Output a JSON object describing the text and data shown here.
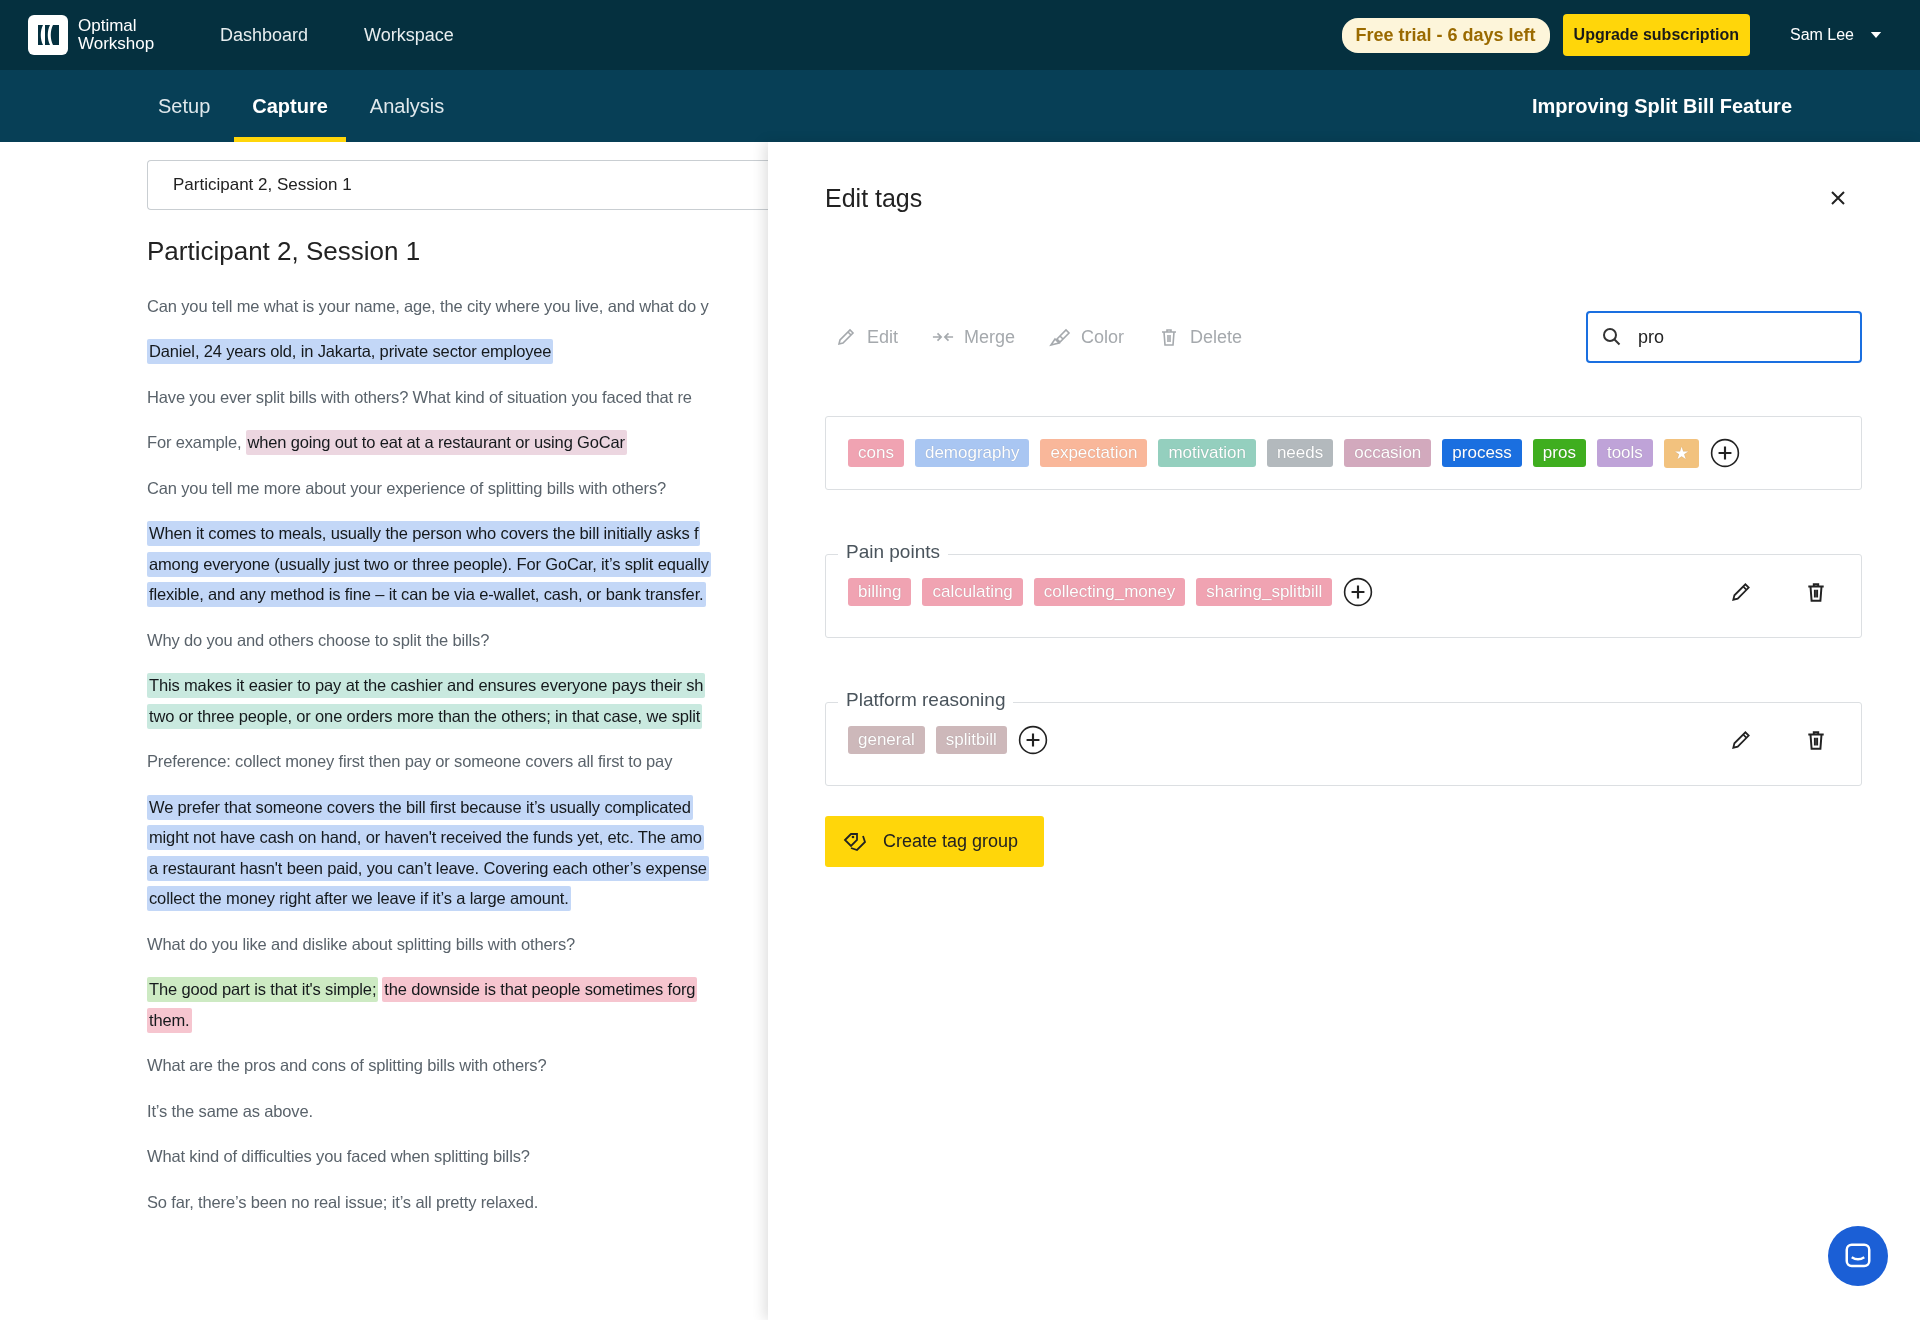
{
  "header": {
    "logo_text": "Optimal Workshop",
    "nav": [
      {
        "label": "Dashboard"
      },
      {
        "label": "Workspace"
      }
    ],
    "trial": "Free trial - 6 days left",
    "upgrade": "Upgrade subscription",
    "user": "Sam Lee"
  },
  "subnav": {
    "tabs": [
      {
        "label": "Setup",
        "selected": false
      },
      {
        "label": "Capture",
        "selected": true
      },
      {
        "label": "Analysis",
        "selected": false
      }
    ],
    "project": "Improving Split Bill Feature"
  },
  "session_select": {
    "value": "Participant 2, Session 1"
  },
  "transcript": {
    "title": "Participant 2, Session 1",
    "paragraphs": [
      {
        "lines": [
          [
            {
              "text": "Can you tell me what is your name, age, the city where you live, and what do y"
            }
          ]
        ]
      },
      {
        "lines": [
          [
            {
              "text": "Daniel, 24 years old, in Jakarta, private sector employee",
              "color": "#c3d7f7"
            }
          ]
        ]
      },
      {
        "lines": [
          [
            {
              "text": "Have you ever split bills with others? What kind of situation you faced that re"
            }
          ]
        ]
      },
      {
        "lines": [
          [
            {
              "text": "For example,"
            },
            {
              "text": "when going out to eat at a restaurant or using GoCar",
              "color": "#ecd6e0"
            }
          ]
        ]
      },
      {
        "lines": [
          [
            {
              "text": "Can you tell me more about your experience of splitting bills with others?"
            }
          ]
        ]
      },
      {
        "lines": [
          [
            {
              "text": "When it comes to meals, usually the person who covers the bill initially asks f",
              "color": "#c3d7f7"
            }
          ],
          [
            {
              "text": "among everyone (usually just two or three people). For GoCar, it’s split equally",
              "color": "#c3d7f7"
            }
          ],
          [
            {
              "text": "flexible, and any method is fine – it can be via e-wallet, cash, or bank transfer.",
              "color": "#c3d7f7"
            }
          ]
        ]
      },
      {
        "lines": [
          [
            {
              "text": "Why do you and others choose to split the bills?"
            }
          ]
        ]
      },
      {
        "lines": [
          [
            {
              "text": "This makes it easier to pay at the cashier and ensures everyone pays their sh",
              "color": "#c9e9df"
            }
          ],
          [
            {
              "text": "two or three people, or one orders more than the others; in that case, we split",
              "color": "#c9e9df"
            }
          ]
        ]
      },
      {
        "lines": [
          [
            {
              "text": "Preference: collect money first then pay or someone covers all first to pay"
            }
          ]
        ]
      },
      {
        "lines": [
          [
            {
              "text": "We prefer that someone covers the bill first because it’s usually complicated",
              "color": "#c3d7f7"
            }
          ],
          [
            {
              "text": "might not have cash on hand, or haven't received the funds yet, etc. The amo",
              "color": "#c3d7f7"
            }
          ],
          [
            {
              "text": "a restaurant hasn't been paid, you can’t leave. Covering each other’s expense",
              "color": "#c3d7f7"
            }
          ],
          [
            {
              "text": "collect the money right after we leave if it’s a large amount.",
              "color": "#c3d7f7"
            }
          ]
        ]
      },
      {
        "lines": [
          [
            {
              "text": "What do you like and dislike about splitting bills with others?"
            }
          ]
        ]
      },
      {
        "lines": [
          [
            {
              "text": "The good part is that it's simple;",
              "color": "#cdeac3"
            },
            {
              "text": "the downside is that people sometimes forg",
              "color": "#f6c5cf"
            }
          ],
          [
            {
              "text": "them.",
              "color": "#f6c5cf"
            }
          ]
        ]
      },
      {
        "lines": [
          [
            {
              "text": "What are the pros and cons of splitting bills with others?"
            }
          ]
        ]
      },
      {
        "lines": [
          [
            {
              "text": "It’s the same as above."
            }
          ]
        ]
      },
      {
        "lines": [
          [
            {
              "text": "What kind of difficulties you faced when splitting bills?"
            }
          ]
        ]
      },
      {
        "lines": [
          [
            {
              "text": "So far, there’s been no real issue; it’s all pretty relaxed."
            }
          ]
        ]
      }
    ]
  },
  "edit_tags": {
    "title": "Edit tags",
    "toolbar": [
      {
        "kind": "edit",
        "label": "Edit",
        "disabled": true
      },
      {
        "kind": "merge",
        "label": "Merge",
        "disabled": true
      },
      {
        "kind": "color",
        "label": "Color",
        "disabled": true
      },
      {
        "kind": "delete",
        "label": "Delete",
        "disabled": true
      }
    ],
    "search": {
      "value": "pro",
      "focused": true
    },
    "tags": [
      {
        "label": "cons",
        "color": "#f0a3b2"
      },
      {
        "label": "demography",
        "color": "#a9c6f2"
      },
      {
        "label": "expectation",
        "color": "#f9b79a"
      },
      {
        "label": "motivation",
        "color": "#94cfbe"
      },
      {
        "label": "needs",
        "color": "#b3b9bd"
      },
      {
        "label": "occasion",
        "color": "#d2a9bd"
      },
      {
        "label": "process",
        "color": "#1a6fe0"
      },
      {
        "label": "pros",
        "color": "#3fae1f"
      },
      {
        "label": "tools",
        "color": "#bfa3d8"
      },
      {
        "label": "★",
        "color": "#f2c27e"
      }
    ],
    "groups": [
      {
        "title": "Pain points",
        "tags": [
          {
            "label": "billing",
            "color": "#f0a3b2"
          },
          {
            "label": "calculating",
            "color": "#f0a3b2"
          },
          {
            "label": "collecting_money",
            "color": "#f0a3b2"
          },
          {
            "label": "sharing_splitbill",
            "color": "#f0a3b2"
          }
        ]
      },
      {
        "title": "Platform reasoning",
        "tags": [
          {
            "label": "general",
            "color": "#cdb8ba"
          },
          {
            "label": "splitbill",
            "color": "#cdb8ba"
          }
        ]
      }
    ],
    "create_button": "Create tag group"
  }
}
